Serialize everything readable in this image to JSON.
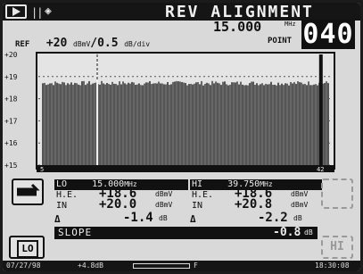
{
  "header": {
    "title": "REV ALIGNMENT",
    "bars_glyph": "||",
    "frequency": "15.000",
    "frequency_unit": "MHz",
    "point_label": "POINT",
    "point_value": "040"
  },
  "ref": {
    "label": "REF",
    "value": "+20",
    "unit": "dBmV",
    "scale": "/0.5",
    "scale_unit": "dB/div"
  },
  "chart": {
    "y_ticks": [
      "+20",
      "+19",
      "+18",
      "+17",
      "+16",
      "+15"
    ],
    "y_range": [
      15,
      20
    ],
    "x_start_label": "5",
    "x_end_label": "42",
    "marker_lines": [
      0.2,
      0.96
    ]
  },
  "lo": {
    "label": "LO",
    "freq": "15.000",
    "freq_unit": "MHz",
    "he_label": "H.E.",
    "he_value": "+18.6",
    "he_unit": "dBmV",
    "in_label": "IN",
    "in_value": "+20.0",
    "in_unit": "dBmV",
    "delta_value": "-1.4",
    "delta_unit": "dB",
    "button": "LO"
  },
  "hi": {
    "label": "HI",
    "freq": "39.750",
    "freq_unit": "MHz",
    "he_label": "H.E.",
    "he_value": "+18.6",
    "he_unit": "dBmV",
    "in_label": "IN",
    "in_value": "+20.8",
    "in_unit": "dBmV",
    "delta_value": "-2.2",
    "delta_unit": "dB",
    "button": "HI"
  },
  "slope": {
    "label": "SLOPE",
    "value": "-0.8",
    "unit": "dB"
  },
  "delta_symbol": "Δ",
  "status": {
    "date": "07/27/98",
    "level": "+4.8dB",
    "battery_f": "F",
    "time": "18:30:08"
  }
}
